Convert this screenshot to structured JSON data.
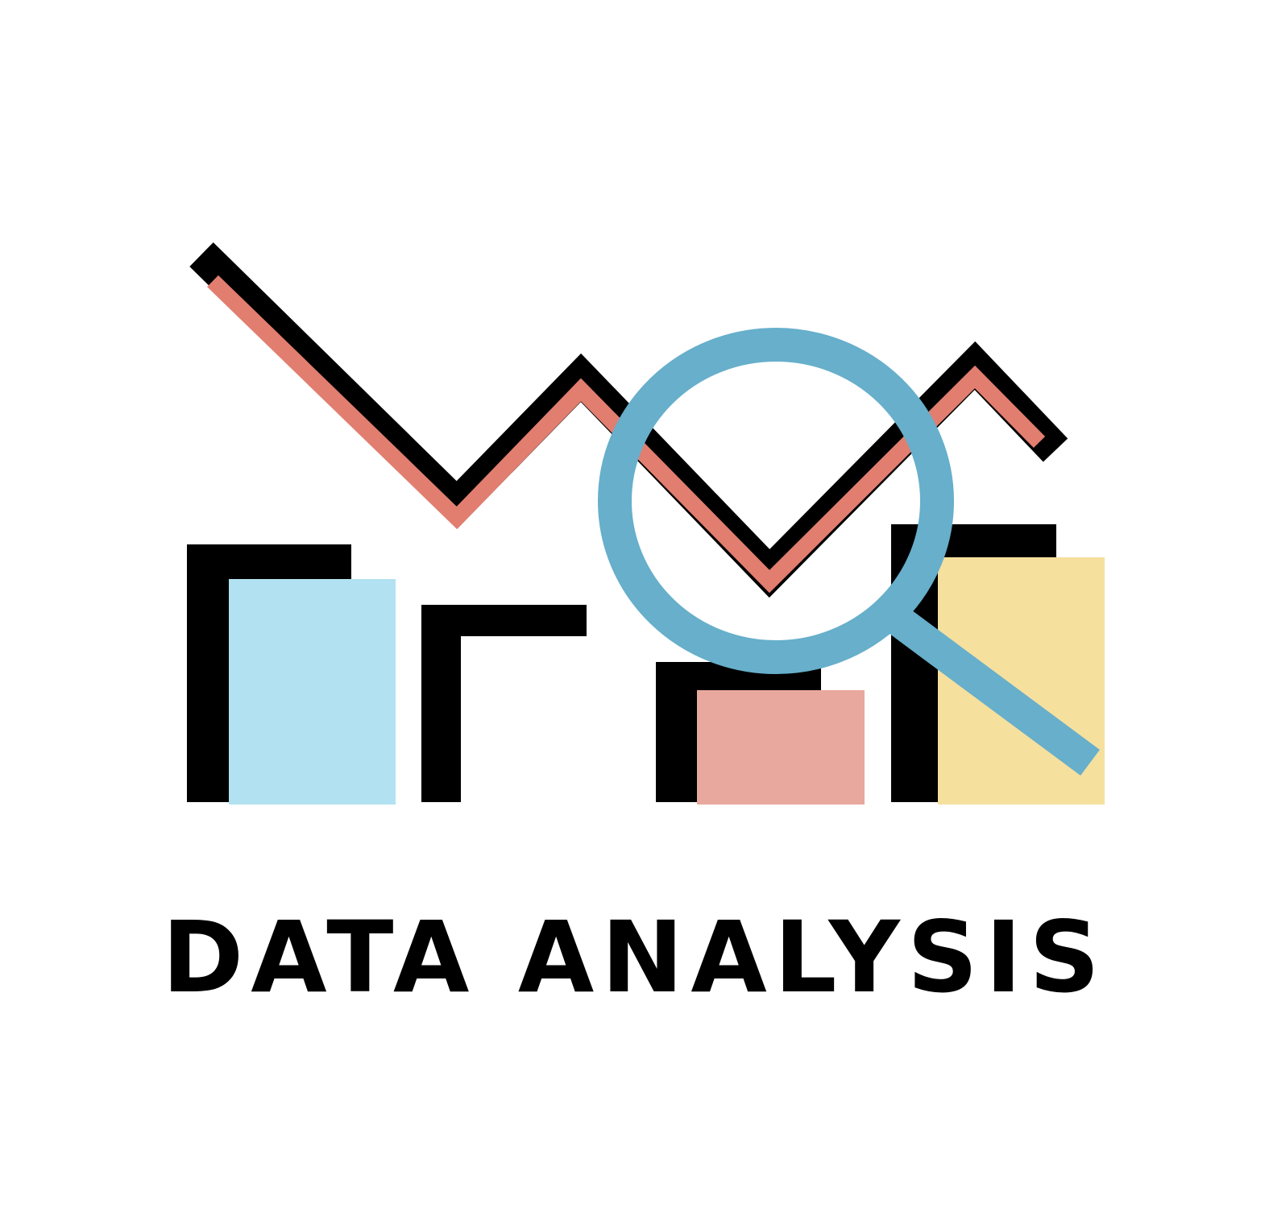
{
  "caption": {
    "text": "DATA ANALYSIS"
  },
  "illustration": {
    "icon": "data-analysis-icon",
    "elements": [
      "bar-chart",
      "line-chart",
      "magnifying-glass"
    ]
  },
  "colors": {
    "background": "#ffffff",
    "outline": "#000000",
    "bar_1": "#b2e2f1",
    "bar_2": "#ffffff",
    "bar_3": "#e8a89e",
    "bar_4": "#f6e09e",
    "trend_line": "#e17e70",
    "magnifier": "#67afcb"
  }
}
